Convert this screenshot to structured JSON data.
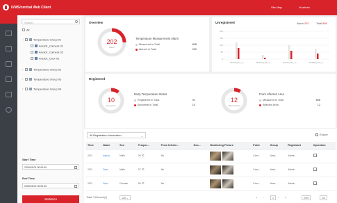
{
  "app": {
    "title": "iVMS/central Web Client",
    "site_map": "Site Map",
    "user": "Hi admin"
  },
  "rail_icons": [
    "temperature-icon",
    "monitor-icon",
    "bell-icon",
    "file-icon",
    "calendar-icon",
    "chart-icon",
    "gear-icon"
  ],
  "tree": {
    "search_placeholder": "Search",
    "all_label": "All",
    "items": [
      {
        "label": "Temperature Group 01",
        "level": 0
      },
      {
        "label": "Area01_Camera 01",
        "level": 1
      },
      {
        "label": "Area01_Camera 02",
        "level": 1
      },
      {
        "label": "Area01_Door 01",
        "level": 1
      },
      {
        "label": "Temperature Group 02",
        "level": 0
      },
      {
        "label": "Temperature Group 03",
        "level": 0
      },
      {
        "label": "Temperature Group 04",
        "level": 0
      }
    ],
    "start_time_label": "Start Time",
    "start_time_value": "2020/01/01 00:00:00",
    "end_time_label": "End Time",
    "end_time_value": "2020/01/01 00:00:00",
    "statistics_button": "Statistics"
  },
  "overview": {
    "title": "Overview",
    "donut_value": "202",
    "donut_caption": "Alarm",
    "subtitle": "Temperature Measurement Alarm",
    "rows": [
      {
        "label": "Measured in Total",
        "value": "808",
        "color": "#cccccc"
      },
      {
        "label": "Alarms in Total",
        "value": "202",
        "color": "#d9232a"
      }
    ],
    "alarm_fraction": 0.25
  },
  "unregistered": {
    "title": "Unregistered",
    "legend_alarm": "Alarm",
    "legend_alarm_value": "202",
    "legend_total": "Total",
    "legend_total_value": "808",
    "y_ticks": [
      "200",
      "150",
      "100",
      "50",
      "0"
    ],
    "categories": [
      "Building A1_m...",
      "Building A2_m...",
      "Building A3_m...",
      "Building A4_m..."
    ],
    "series_total": [
      120,
      30,
      100,
      70
    ],
    "series_alarm": [
      80,
      10,
      60,
      40
    ],
    "ymax": 200
  },
  "registered": {
    "title": "Registered",
    "left": {
      "donut_value": "10",
      "donut_caption": "Exception",
      "subtitle": "Body Temperature Status",
      "rows": [
        {
          "label": "Registered in Total",
          "value": "91",
          "color": "#cccccc"
        },
        {
          "label": "Abnormal in Total",
          "value": "10",
          "color": "#d9232a"
        }
      ],
      "fraction": 0.11
    },
    "right": {
      "donut_value": "12",
      "donut_caption": "Affected Area",
      "subtitle": "From Affected Area",
      "rows": [
        {
          "label": "Measured in Total",
          "value": "808",
          "color": "#cccccc"
        },
        {
          "label": "Affected Area",
          "value": "12",
          "color": "#d9232a"
        }
      ],
      "fraction": 0.09
    }
  },
  "table": {
    "filter_value": "All Registration Information",
    "export_label": "Export",
    "columns": [
      "Time",
      "Name",
      "Sex",
      "Temper...",
      "From Infecte...",
      "Des...",
      "Monitoring Picture",
      "Point",
      "Group",
      "Registrant",
      "Operation"
    ],
    "rows": [
      {
        "time": "202...",
        "name": "nahzu",
        "sex": "Male",
        "temp": "36 ℃",
        "from": "No",
        "des": "",
        "point": "Cam...",
        "group": "Area...",
        "registrant": "Admin"
      },
      {
        "time": "202...",
        "name": "Sam",
        "sex": "Male",
        "temp": "37 ℃",
        "from": "No",
        "des": "",
        "point": "Cam...",
        "group": "Area...",
        "registrant": "Admin"
      },
      {
        "time": "202...",
        "name": "Sam",
        "sex": "Female",
        "temp": "36 ℃",
        "from": "No",
        "des": "",
        "point": "Cam...",
        "group": "Area...",
        "registrant": "Admin"
      }
    ],
    "pager": {
      "total": "Total: 3 Record(s)",
      "per_page": "100",
      "page": "1",
      "goto_page": "2/99",
      "go_label": "Go"
    }
  }
}
